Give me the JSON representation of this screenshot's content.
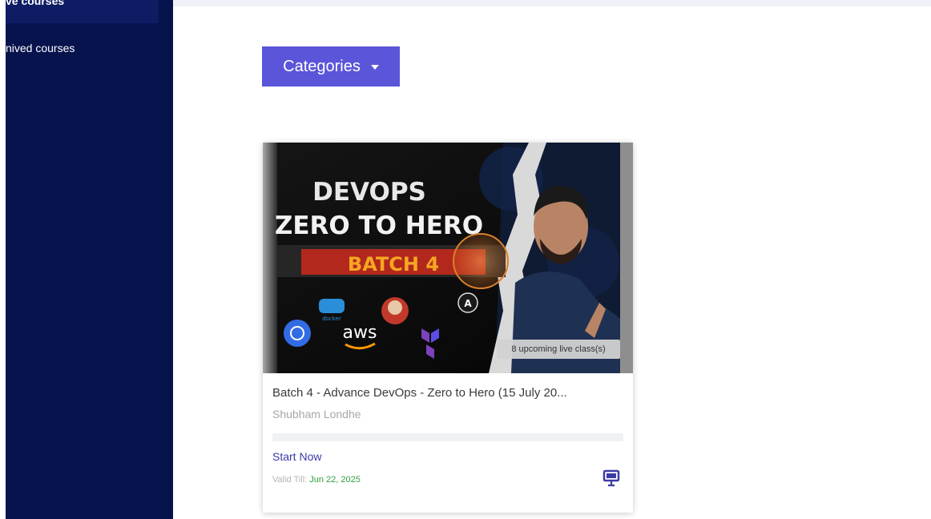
{
  "sidebar": {
    "items": [
      {
        "label": "ve courses",
        "active": true
      },
      {
        "label": "nived courses",
        "active": false
      }
    ],
    "bg_color": "#06134d"
  },
  "main": {
    "categories_button": {
      "label": "Categories",
      "icon": "caret-down-icon",
      "color": "#5a55d9"
    }
  },
  "course_card": {
    "thumbnail": {
      "line1": "DEVOPS",
      "line2": "ZERO TO HERO",
      "line3": "BATCH 4",
      "aws_label": "aws",
      "tool_logos": [
        "kubernetes-icon",
        "docker-icon",
        "jenkins-icon",
        "ansible-icon",
        "terraform-icon"
      ],
      "live_badge": "8 upcoming live class(s)"
    },
    "title": "Batch 4 - Advance DevOps - Zero to Hero (15 July 20...",
    "instructor": "Shubham Londhe",
    "progress": 0,
    "start_label": "Start Now",
    "valid_label": "Valid Till:",
    "valid_date": "Jun 22, 2025",
    "live_class_icon": "presentation-icon"
  }
}
